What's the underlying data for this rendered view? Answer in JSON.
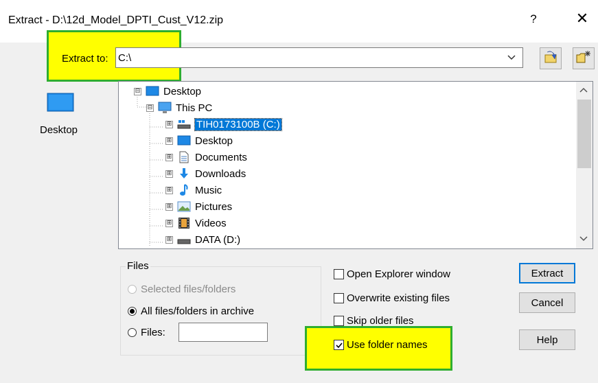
{
  "window": {
    "title": "Extract - D:\\12d_Model_DPTI_Cust_V12.zip",
    "help_label": "?",
    "close_label": "✕"
  },
  "extract_to": {
    "label": "Extract to:",
    "value": "C:\\"
  },
  "places": [
    {
      "label": "Desktop",
      "icon": "desktop-icon"
    }
  ],
  "tree": {
    "items": [
      {
        "label": "Desktop",
        "icon": "desktop-icon",
        "expander": "⊟"
      },
      {
        "label": "This PC",
        "icon": "computer-icon",
        "expander": "⊟"
      },
      {
        "label": "TIH0173100B (C:)",
        "icon": "drive-c-icon",
        "expander": "⊞",
        "selected": true
      },
      {
        "label": "Desktop",
        "icon": "desktop-icon",
        "expander": "⊞"
      },
      {
        "label": "Documents",
        "icon": "document-icon",
        "expander": "⊞"
      },
      {
        "label": "Downloads",
        "icon": "download-icon",
        "expander": "⊞"
      },
      {
        "label": "Music",
        "icon": "music-icon",
        "expander": "⊞"
      },
      {
        "label": "Pictures",
        "icon": "picture-icon",
        "expander": "⊞"
      },
      {
        "label": "Videos",
        "icon": "video-icon",
        "expander": "⊞"
      },
      {
        "label": "DATA (D:)",
        "icon": "drive-icon",
        "expander": "⊞"
      }
    ]
  },
  "files_group": {
    "legend": "Files",
    "options": [
      {
        "label": "Selected files/folders",
        "checked": false,
        "disabled": true
      },
      {
        "label": "All files/folders in archive",
        "checked": true,
        "disabled": false
      },
      {
        "label": "Files:",
        "checked": false,
        "disabled": false
      }
    ],
    "files_value": ""
  },
  "options": [
    {
      "label": "Open Explorer window",
      "checked": false
    },
    {
      "label": "Overwrite existing files",
      "checked": false
    },
    {
      "label": "Skip older files",
      "checked": false
    },
    {
      "label": "Use folder names",
      "checked": true
    }
  ],
  "buttons": {
    "extract": "Extract",
    "cancel": "Cancel",
    "help": "Help"
  },
  "colors": {
    "highlight": "#ffff00",
    "highlight_border": "#2fae2f",
    "selection": "#0078d7"
  }
}
